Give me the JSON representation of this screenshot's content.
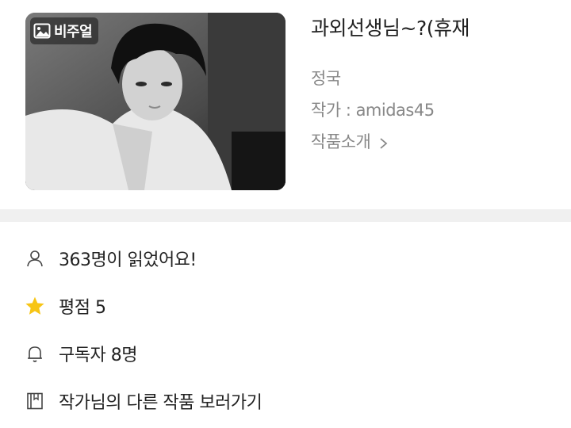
{
  "work": {
    "badge_label": "비주얼",
    "title": "과외선생님~?(휴재",
    "genre": "정국",
    "author": "작가 : amidas45",
    "intro_link": "작품소개"
  },
  "stats": [
    {
      "icon": "person-icon",
      "text": "363명이 읽었어요!"
    },
    {
      "icon": "star-icon",
      "text": "평점 5"
    },
    {
      "icon": "bell-icon",
      "text": "구독자 8명"
    },
    {
      "icon": "book-icon",
      "text": "작가님의 다른 작품 보러가기"
    }
  ],
  "colors": {
    "star": "#F7C515",
    "muted": "#888888",
    "divider": "#F0F0F0"
  }
}
